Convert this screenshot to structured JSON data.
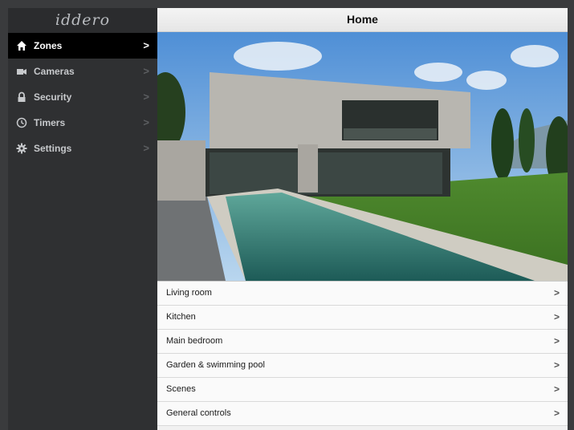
{
  "app": {
    "logo": "iddero"
  },
  "sidebar": {
    "items": [
      {
        "label": "Zones",
        "icon": "home-icon",
        "chevron": ">"
      },
      {
        "label": "Cameras",
        "icon": "camera-icon",
        "chevron": ">"
      },
      {
        "label": "Security",
        "icon": "lock-icon",
        "chevron": ">"
      },
      {
        "label": "Timers",
        "icon": "clock-icon",
        "chevron": ">"
      },
      {
        "label": "Settings",
        "icon": "gear-icon",
        "chevron": ">"
      }
    ]
  },
  "header": {
    "title": "Home"
  },
  "zones": [
    {
      "label": "Living room",
      "chevron": ">"
    },
    {
      "label": "Kitchen",
      "chevron": ">"
    },
    {
      "label": "Main bedroom",
      "chevron": ">"
    },
    {
      "label": "Garden & swimming pool",
      "chevron": ">"
    },
    {
      "label": "Scenes",
      "chevron": ">"
    },
    {
      "label": "General controls",
      "chevron": ">"
    }
  ],
  "colors": {
    "sidebar_bg": "#2f3032",
    "active_bg": "#000000",
    "list_bg": "#fafafa"
  }
}
